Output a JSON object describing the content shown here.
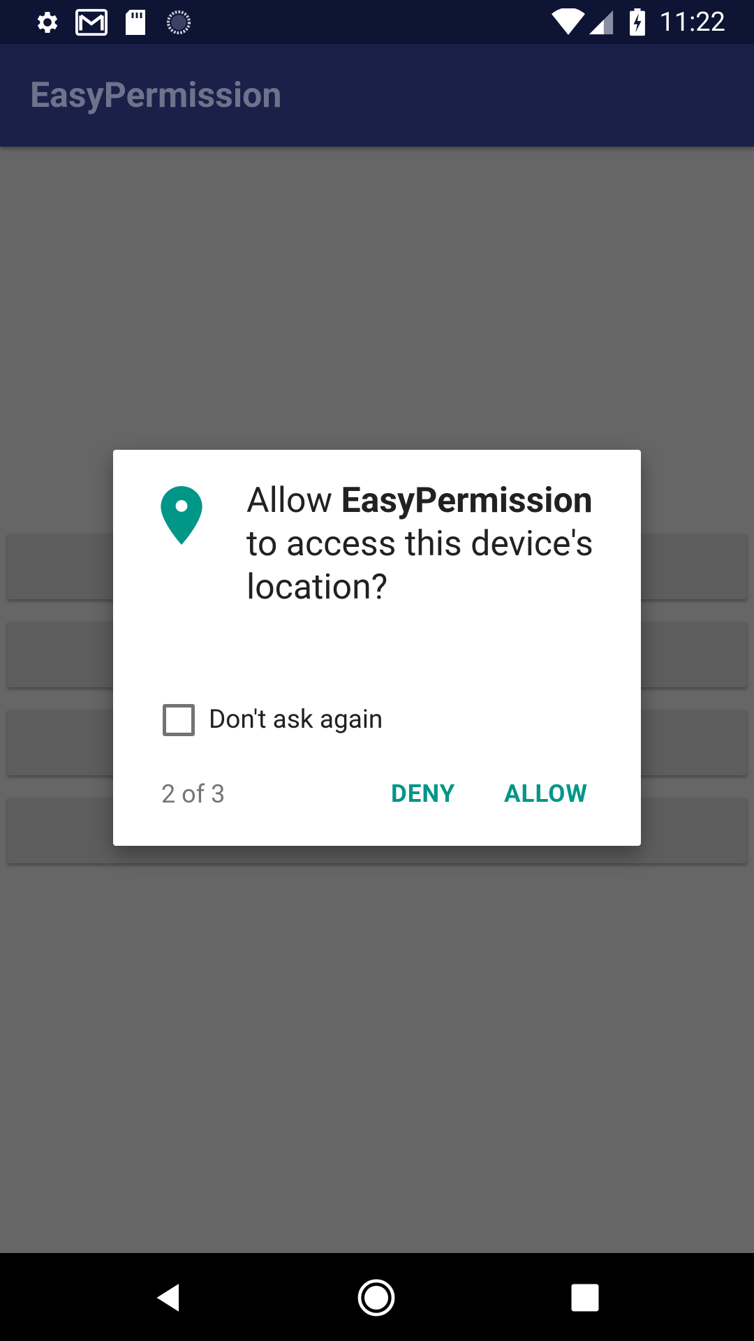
{
  "status_bar": {
    "time": "11:22",
    "left_icons": [
      "gear-icon",
      "gmail-icon",
      "sd-card-icon",
      "sync-icon"
    ],
    "right_icons": [
      "wifi-icon",
      "cell-signal-icon",
      "battery-charging-icon"
    ]
  },
  "app_bar": {
    "title": "EasyPermission"
  },
  "dialog": {
    "icon": "location-pin-icon",
    "message_prefix": "Allow ",
    "app_name": "EasyPermission",
    "message_suffix": " to access this device's location?",
    "checkbox_label": "Don't ask again",
    "checkbox_checked": false,
    "counter": "2 of 3",
    "deny_label": "DENY",
    "allow_label": "ALLOW",
    "accent_color": "#009688"
  },
  "nav_bar": {
    "icons": [
      "back-icon",
      "home-icon",
      "recents-icon"
    ]
  }
}
